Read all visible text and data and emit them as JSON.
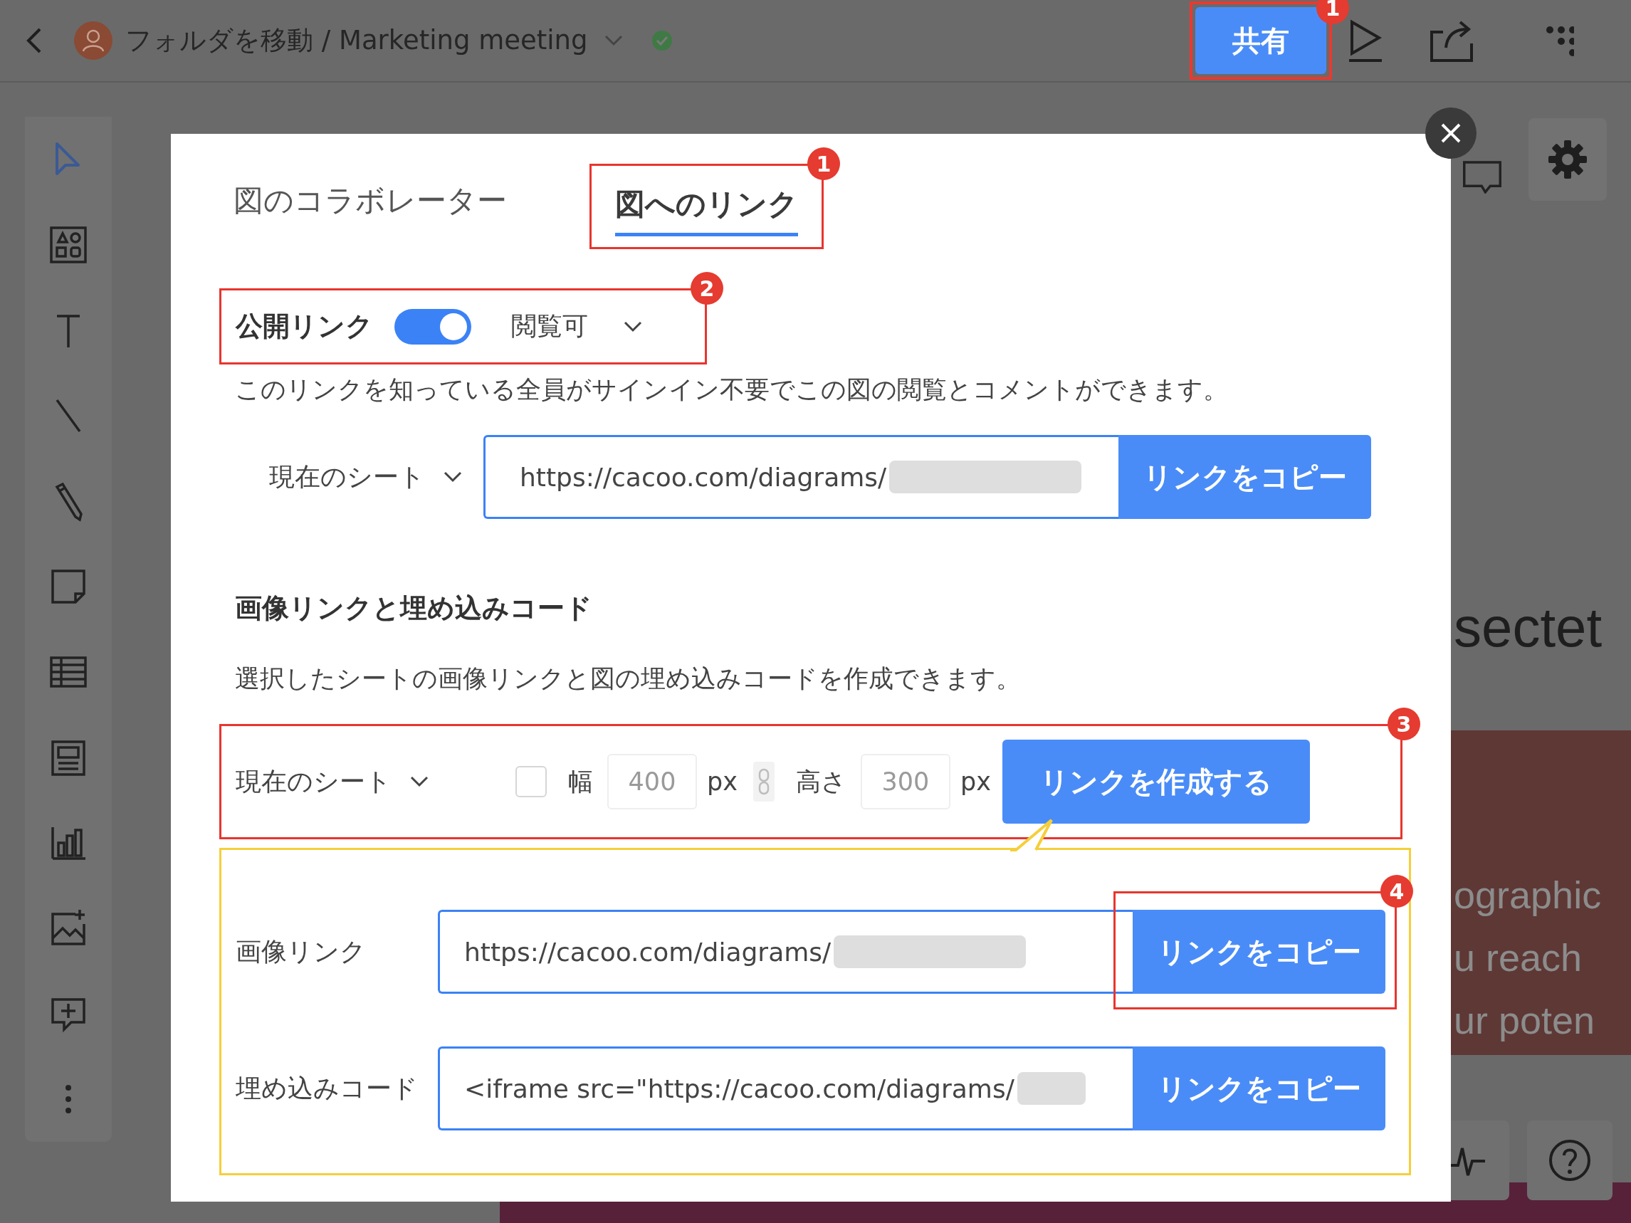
{
  "top_bar": {
    "title": "フォルダを移動 / Marketing meeting",
    "share_button": "共有",
    "share_badge": "1"
  },
  "canvas_texts": [
    {
      "text": "sectet",
      "kind": "heading"
    },
    {
      "text": "ographic",
      "kind": "banner"
    },
    {
      "text": "u reach",
      "kind": "banner"
    },
    {
      "text": "ur poten",
      "kind": "banner"
    }
  ],
  "dialog": {
    "tabs": [
      {
        "label": "図のコラボレーター",
        "selected": false
      },
      {
        "label": "図へのリンク",
        "selected": true,
        "badge": "1"
      }
    ],
    "public_link": {
      "label": "公開リンク",
      "on": true,
      "permission": "閲覧可",
      "badge": "2",
      "description": "このリンクを知っている全員がサインイン不要でこの図の閲覧とコメントができます。",
      "sheet": "現在のシート",
      "url": "https://cacoo.com/diagrams/",
      "copy_button": "リンクをコピー"
    },
    "image_section": {
      "heading": "画像リンクと埋め込みコード",
      "description": "選択したシートの画像リンクと図の埋め込みコードを作成できます。",
      "badge": "3",
      "sheet": "現在のシート",
      "checked": false,
      "width_label": "幅",
      "width_placeholder": "400",
      "width_unit": "px",
      "height_label": "高さ",
      "height_placeholder": "300",
      "height_unit": "px",
      "create_button": "リンクを作成する",
      "links": [
        {
          "label": "画像リンク",
          "value": "https://cacoo.com/diagrams/",
          "button": "リンクをコピー",
          "badge": "4"
        },
        {
          "label": "埋め込みコード",
          "value": "<iframe src=\"https://cacoo.com/diagrams/",
          "button": "リンクをコピー"
        }
      ]
    }
  }
}
